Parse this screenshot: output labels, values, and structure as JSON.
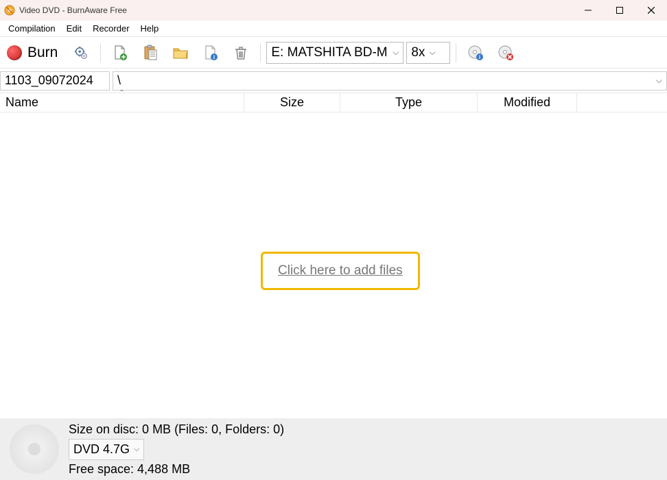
{
  "title": "Video DVD - BurnAware Free",
  "menu": {
    "compilation": "Compilation",
    "edit": "Edit",
    "recorder": "Recorder",
    "help": "Help"
  },
  "toolbar": {
    "burn": "Burn",
    "drive": "E: MATSHITA BD-ML",
    "speed": "8x"
  },
  "icons": {
    "gear": "options",
    "add": "add-file",
    "paste": "paste",
    "folder": "folder",
    "fileinfo": "properties",
    "delete": "delete",
    "discinfo": "disc-info",
    "erase": "erase-disc"
  },
  "disc_name": "1103_09072024",
  "path": "\\",
  "columns": {
    "name": "Name",
    "size": "Size",
    "type": "Type",
    "modified": "Modified"
  },
  "add_files_link": "Click here to add files",
  "status": {
    "size_line": "Size on disc: 0 MB (Files: 0, Folders: 0)",
    "disc_type": "DVD 4.7G",
    "free_line": "Free space: 4,488 MB"
  }
}
